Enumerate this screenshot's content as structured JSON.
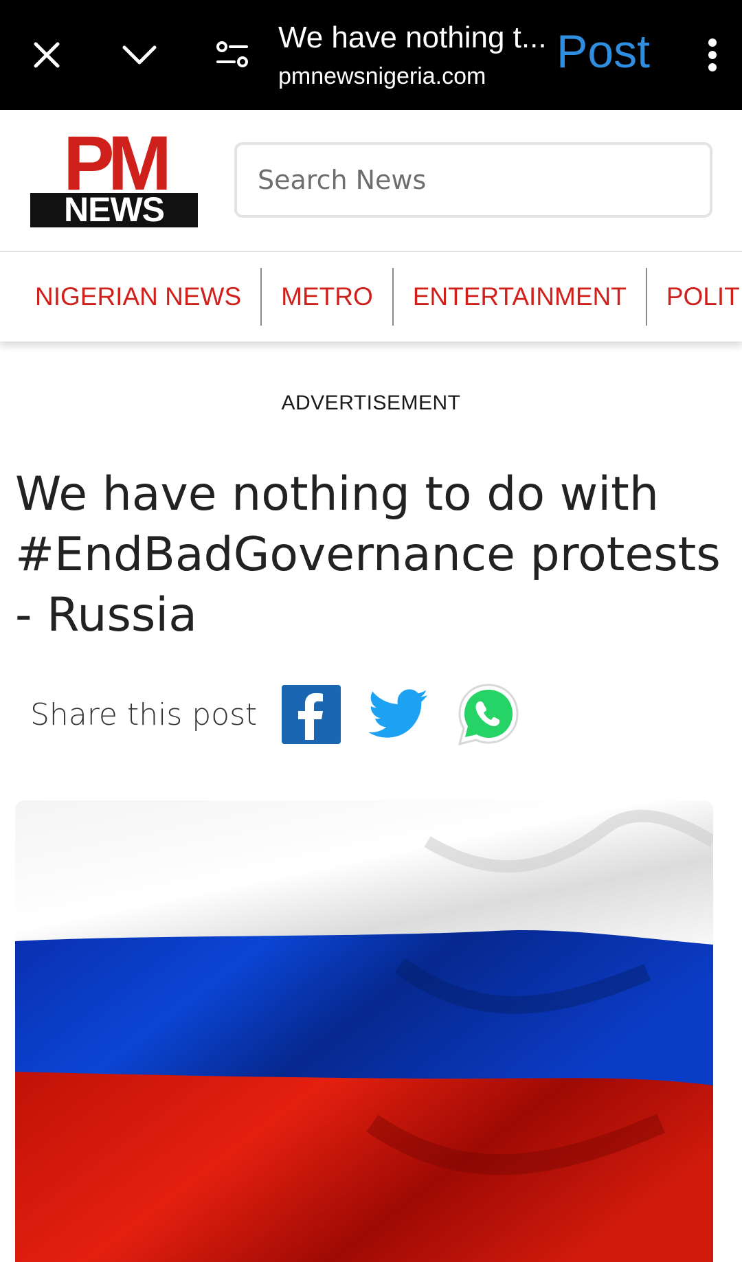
{
  "browser": {
    "page_title": "We have nothing t...",
    "url": "pmnewsnigeria.com",
    "action_label": "Post",
    "icons": [
      "close-icon",
      "chevron-down-icon",
      "page-settings-icon",
      "more-vertical-icon"
    ]
  },
  "site": {
    "logo_text_top": "PM",
    "logo_text_bottom": "NEWS",
    "search_placeholder": "Search News"
  },
  "nav": {
    "items": [
      {
        "label": "NIGERIAN NEWS"
      },
      {
        "label": "METRO"
      },
      {
        "label": "ENTERTAINMENT"
      },
      {
        "label": "POLITICS"
      }
    ]
  },
  "article": {
    "ad_label": "ADVERTISEMENT",
    "headline": "We have nothing to do with #EndBadGovernance protests - Russia",
    "share_label": "Share this post",
    "share_icons": [
      "facebook-icon",
      "twitter-icon",
      "whatsapp-icon"
    ]
  },
  "colors": {
    "brand_red": "#d0201b",
    "post_blue": "#2f8ee0",
    "facebook": "#1a66b3",
    "twitter": "#1da1f2",
    "whatsapp": "#25d366"
  }
}
